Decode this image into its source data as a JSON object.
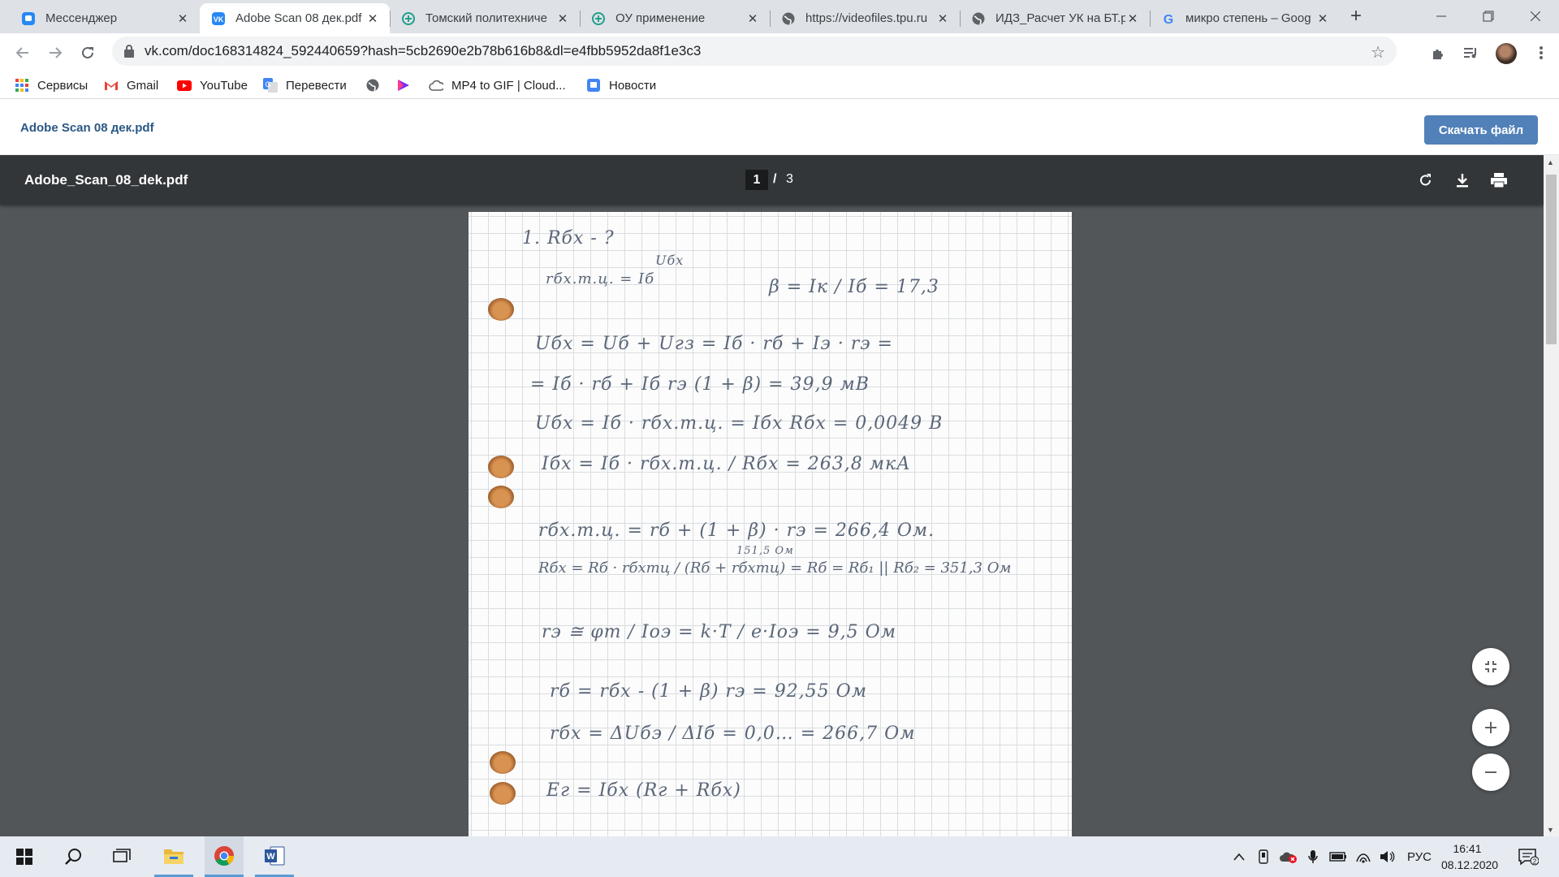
{
  "tabs": [
    {
      "title": "Мессенджер",
      "icon": "vk-messenger-icon",
      "color": "#2787f5"
    },
    {
      "title": "Adobe Scan 08 дек.pdf",
      "icon": "vk-icon",
      "color": "#2787f5"
    },
    {
      "title": "Томский политехниче",
      "icon": "tpu-icon",
      "color": "#20a08c"
    },
    {
      "title": "ОУ применение",
      "icon": "tpu-icon",
      "color": "#20a08c"
    },
    {
      "title": "https://videofiles.tpu.ru",
      "icon": "globe-icon",
      "color": "#5f6368"
    },
    {
      "title": "ИДЗ_Расчет УК на БТ.р",
      "icon": "globe-icon",
      "color": "#5f6368"
    },
    {
      "title": "микро степень – Goog",
      "icon": "google-icon",
      "color": "#4285f4"
    }
  ],
  "url": "vk.com/doc168314824_592440659?hash=5cb2690e2b78b616b8&dl=e4fbb5952da8f1e3c3",
  "bookmarks": [
    {
      "label": "Сервисы",
      "icon": "apps-grid-icon"
    },
    {
      "label": "Gmail",
      "icon": "gmail-icon"
    },
    {
      "label": "YouTube",
      "icon": "youtube-icon"
    },
    {
      "label": "Перевести",
      "icon": "google-translate-icon"
    },
    {
      "label": "",
      "icon": "globe-icon"
    },
    {
      "label": "",
      "icon": "purple-arrow-icon"
    },
    {
      "label": "MP4 to GIF | Cloud...",
      "icon": "cloud-icon"
    },
    {
      "label": "Новости",
      "icon": "news-icon"
    }
  ],
  "vk": {
    "doc_title": "Adobe Scan 08 дек.pdf",
    "download_label": "Скачать файл"
  },
  "viewer": {
    "file_name": "Adobe_Scan_08_dek.pdf",
    "current_page": "1",
    "page_sep": "/",
    "total_pages": "3"
  },
  "handwriting": [
    "1. Rбх - ?",
    "Uбх",
    "rбх.т.ц. = Iб",
    "β = Iк / Iб = 17,3",
    "Uбх = Uб + Uгз = Iб · rб + Iэ · rэ =",
    "= Iб · rб + Iб rэ (1 + β) = 39,9 мВ",
    "Uбх = Iб · rбх.т.ц. = Iбх Rбх = 0,0049 В",
    "Iбх = Iб · rбх.т.ц. / Rбх = 263,8 мкА",
    "rбх.т.ц. = rб + (1 + β) · rэ = 266,4 Ом.",
    "151,5 Ом",
    "Rбх = Rб · rбхтц / (Rб + rбхтц) = Rб = Rб₁ || Rб₂ = 351,3 Ом",
    "rэ ≅ φт / Iоэ = k·T / e·Iоэ = 9,5 Ом",
    "rб = rбх - (1 + β) rэ = 92,55 Ом",
    "rбх = ΔUбэ / ΔIб = 0,0… = 266,7 Ом",
    "Eг = Iбх (Rг + Rбх)"
  ],
  "taskbar": {
    "language": "РУС",
    "time": "16:41",
    "date": "08.12.2020",
    "notifications": "2"
  }
}
